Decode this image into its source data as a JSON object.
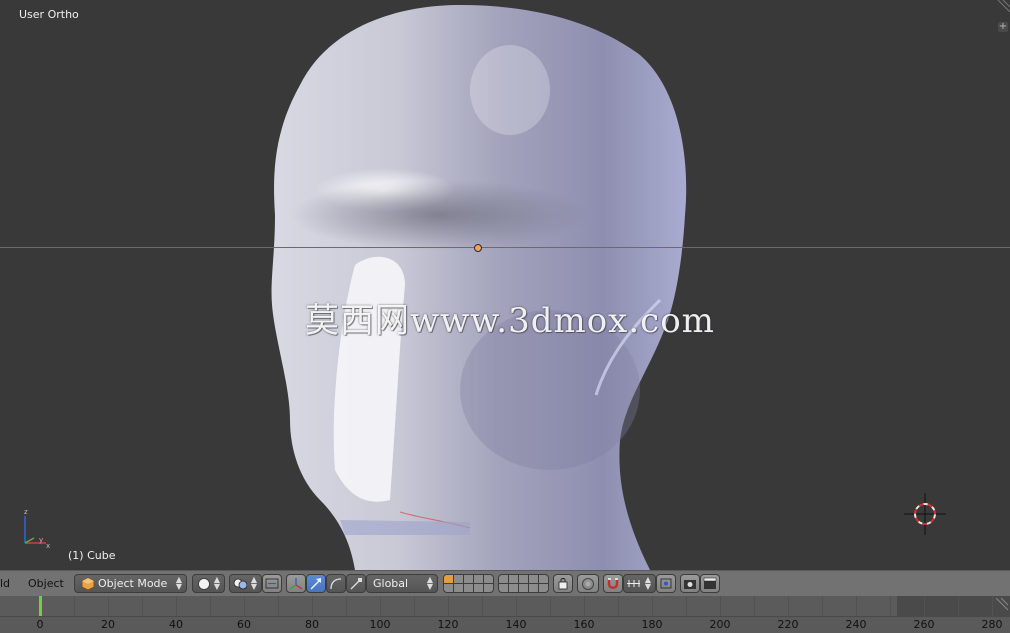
{
  "viewport": {
    "view_label": "User Ortho",
    "object_label": "(1) Cube",
    "watermark": "莫西网www.3dmox.com",
    "add_region_symbol": "+"
  },
  "header": {
    "menu_partial": "ld",
    "menu_object": "Object",
    "mode": "Object Mode",
    "orientation": "Global",
    "colors": {
      "bar": "#727272",
      "active_button": "#5080c8"
    }
  },
  "timeline": {
    "ticks": [
      "0",
      "20",
      "40",
      "60",
      "80",
      "100",
      "120",
      "140",
      "160",
      "180",
      "200",
      "220",
      "240",
      "260",
      "280"
    ],
    "current_frame": 0,
    "playhead_color": "#6fcf4a"
  }
}
